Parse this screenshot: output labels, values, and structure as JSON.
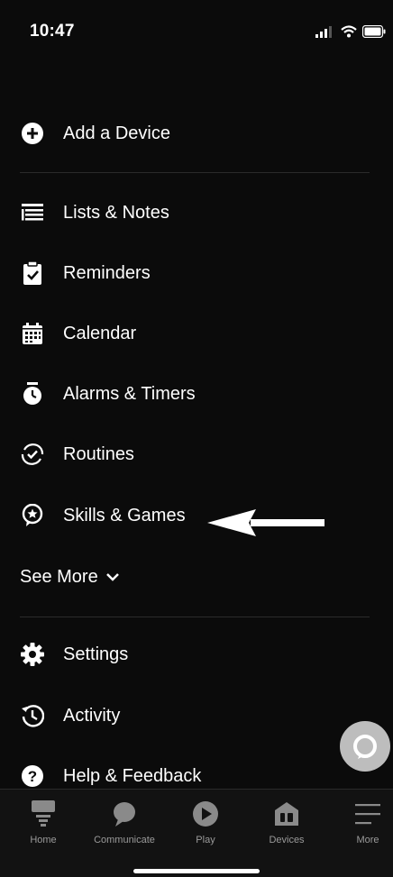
{
  "status": {
    "time": "10:47"
  },
  "menu": {
    "add_device": "Add a Device",
    "items": [
      {
        "label": "Lists & Notes",
        "icon": "list-icon"
      },
      {
        "label": "Reminders",
        "icon": "clipboard-check-icon"
      },
      {
        "label": "Calendar",
        "icon": "calendar-icon"
      },
      {
        "label": "Alarms & Timers",
        "icon": "alarm-clock-icon"
      },
      {
        "label": "Routines",
        "icon": "routines-icon"
      },
      {
        "label": "Skills & Games",
        "icon": "skills-icon"
      }
    ],
    "see_more": "See More",
    "items2": [
      {
        "label": "Settings",
        "icon": "gear-icon"
      },
      {
        "label": "Activity",
        "icon": "history-icon"
      },
      {
        "label": "Help & Feedback",
        "icon": "help-icon"
      }
    ]
  },
  "tabs": [
    "Home",
    "Communicate",
    "Play",
    "Devices",
    "More"
  ],
  "colors": {
    "background": "#0b0b0b",
    "tab_bar": "#121212",
    "tab_label": "#9a9a9a",
    "alexa_button": "#bdbdbd"
  }
}
